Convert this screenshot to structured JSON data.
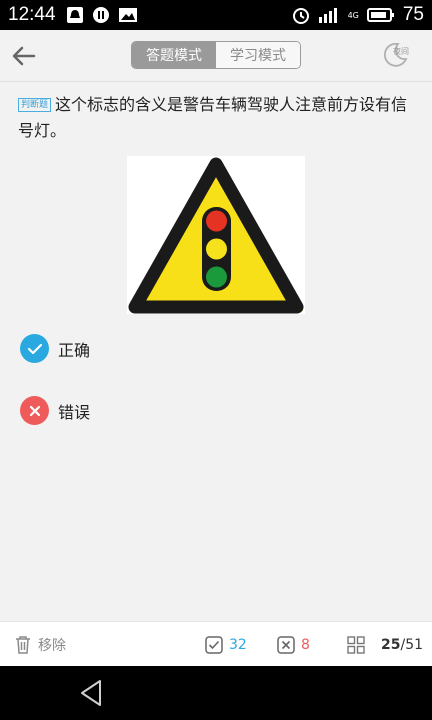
{
  "status_bar": {
    "time": "12:44",
    "battery": "75",
    "network": "4G"
  },
  "header": {
    "modes": [
      {
        "label": "答题模式",
        "active": true
      },
      {
        "label": "学习模式",
        "active": false
      }
    ],
    "night_label": "夜间"
  },
  "question": {
    "type_tag": "判断题",
    "text": "这个标志的含义是警告车辆驾驶人注意前方设有信号灯。"
  },
  "options": [
    {
      "label": "正确",
      "icon": "check-icon",
      "color": "#2aa8e0"
    },
    {
      "label": "错误",
      "icon": "close-icon",
      "color": "#ef5b5b"
    }
  ],
  "bottom_bar": {
    "remove_label": "移除",
    "correct_count": "32",
    "wrong_count": "8",
    "current": "25",
    "total": "/51"
  },
  "colors": {
    "accent": "#2aa8e0",
    "error": "#ef5b5b",
    "sign_yellow": "#f7e017"
  }
}
